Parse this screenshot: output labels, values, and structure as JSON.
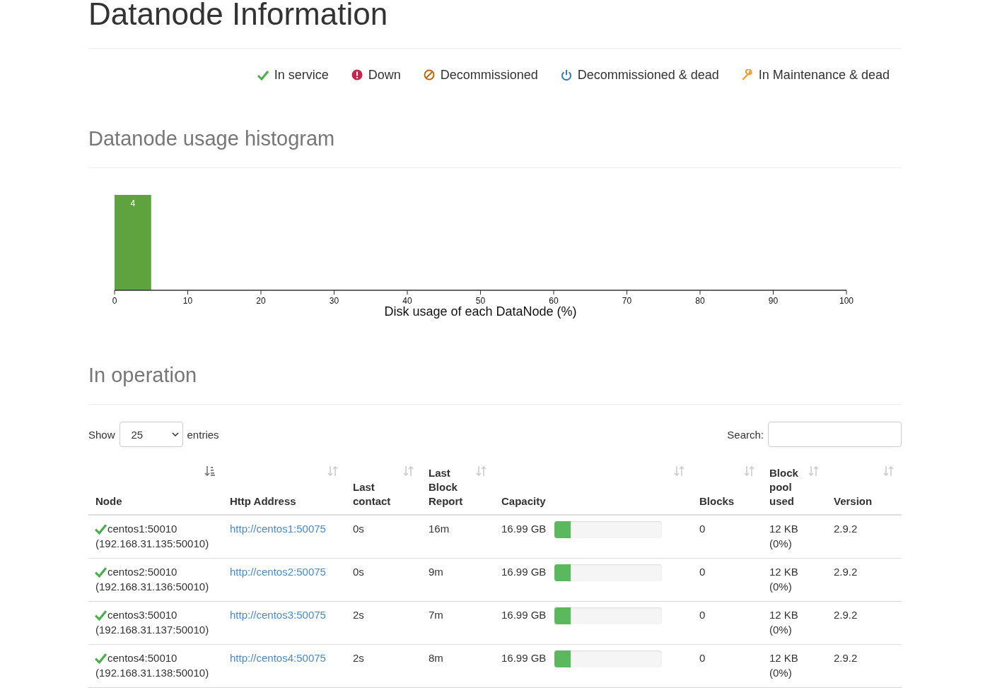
{
  "title": "Datanode Information",
  "legend": [
    {
      "kind": "in-service",
      "label": "In service"
    },
    {
      "kind": "down",
      "label": "Down"
    },
    {
      "kind": "decommissioned",
      "label": "Decommissioned"
    },
    {
      "kind": "decommissioned-dead",
      "label": "Decommissioned & dead"
    },
    {
      "kind": "maintenance-dead",
      "label": "In Maintenance & dead"
    }
  ],
  "histogram": {
    "heading": "Datanode usage histogram",
    "chart_data": {
      "type": "bar",
      "xlabel": "Disk usage of each DataNode (%)",
      "x": [
        2.5
      ],
      "values": [
        4
      ],
      "xlim": [
        0,
        100
      ],
      "xticks": [
        0,
        10,
        20,
        30,
        40,
        50,
        60,
        70,
        80,
        90,
        100
      ],
      "data_labels": true
    }
  },
  "operation": {
    "heading": "In operation",
    "show_label": "Show",
    "page_size": "25",
    "entries_label": "entries",
    "search_label": "Search:",
    "columns": [
      {
        "label": "Node",
        "sorted": true
      },
      {
        "label": "Http Address",
        "sorted": false
      },
      {
        "label": "Last contact",
        "sorted": false
      },
      {
        "label": "Last Block Report",
        "sorted": false
      },
      {
        "label": "Capacity",
        "sorted": false
      },
      {
        "label": "Blocks",
        "sorted": false
      },
      {
        "label": "Block pool used",
        "sorted": false
      },
      {
        "label": "Version",
        "sorted": false
      }
    ],
    "rows": [
      {
        "in_service": true,
        "node": "centos1:50010",
        "address": "(192.168.31.135:50010)",
        "http": "http://centos1:50075",
        "last_contact": "0s",
        "last_block_report": "16m",
        "capacity": "16.99 GB",
        "level": 0.15,
        "blocks": "0",
        "pool_used": "12 KB",
        "pool_pct": "(0%)",
        "version": "2.9.2"
      },
      {
        "in_service": true,
        "node": "centos2:50010",
        "address": "(192.168.31.136:50010)",
        "http": "http://centos2:50075",
        "last_contact": "0s",
        "last_block_report": "9m",
        "capacity": "16.99 GB",
        "level": 0.15,
        "blocks": "0",
        "pool_used": "12 KB",
        "pool_pct": "(0%)",
        "version": "2.9.2"
      },
      {
        "in_service": true,
        "node": "centos3:50010",
        "address": "(192.168.31.137:50010)",
        "http": "http://centos3:50075",
        "last_contact": "2s",
        "last_block_report": "7m",
        "capacity": "16.99 GB",
        "level": 0.15,
        "blocks": "0",
        "pool_used": "12 KB",
        "pool_pct": "(0%)",
        "version": "2.9.2"
      },
      {
        "in_service": true,
        "node": "centos4:50010",
        "address": "(192.168.31.138:50010)",
        "http": "http://centos4:50075",
        "last_contact": "2s",
        "last_block_report": "8m",
        "capacity": "16.99 GB",
        "level": 0.15,
        "blocks": "0",
        "pool_used": "12 KB",
        "pool_pct": "(0%)",
        "version": "2.9.2"
      }
    ]
  }
}
